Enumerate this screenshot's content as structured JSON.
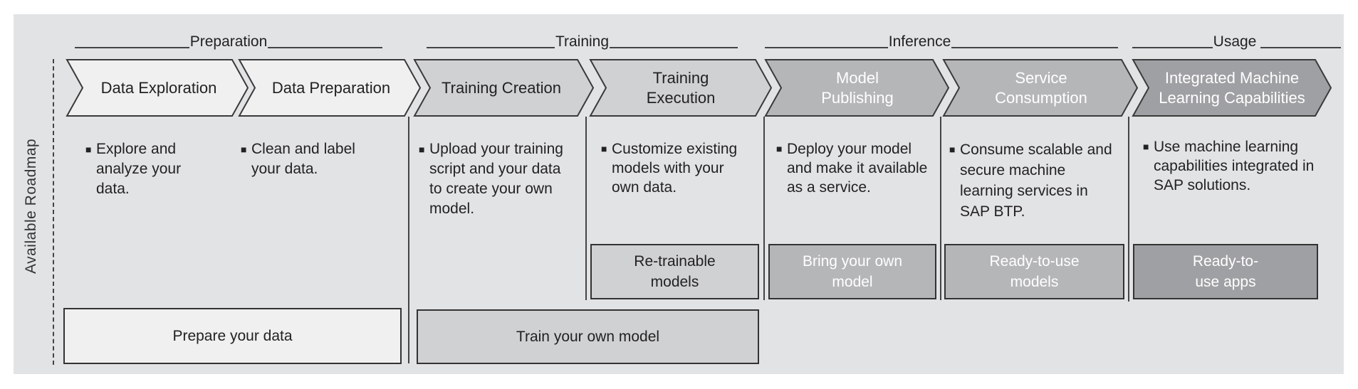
{
  "side_label": "Available Roadmap",
  "phases": [
    {
      "label": "Preparation"
    },
    {
      "label": "Training"
    },
    {
      "label": "Inference"
    },
    {
      "label": "Usage"
    }
  ],
  "steps": [
    {
      "label": "Data Exploration",
      "description": "Explore and analyze your data."
    },
    {
      "label": "Data Preparation",
      "description": "Clean and label your data."
    },
    {
      "label": "Training Creation",
      "description": "Upload your training  script and your data to create your own model."
    },
    {
      "label": "Training Execution",
      "description": "Customize existing models with your own data."
    },
    {
      "label": "Model Publishing",
      "description": "Deploy your model and make it available as a service."
    },
    {
      "label": "Service Consumption",
      "description": "Consume scalable and secure machine learning services in SAP BTP."
    },
    {
      "label": "Integrated Machine Learning Capabilities",
      "description": "Use machine learning capabilities integrated in SAP solutions."
    }
  ],
  "offerings": [
    {
      "label": "Re-trainable models"
    },
    {
      "label": "Bring your own model"
    },
    {
      "label": "Ready-to-use models"
    },
    {
      "label": "Ready-to-use apps"
    },
    {
      "label": "Prepare your data"
    },
    {
      "label": "Train your own model"
    }
  ],
  "colors": {
    "background": "#e2e3e5",
    "preparation": "#f0f0f0",
    "training": "#d0d1d3",
    "inference": "#b5b6b8",
    "usage": "#9fa0a3",
    "stroke": "#3a3a3a"
  }
}
